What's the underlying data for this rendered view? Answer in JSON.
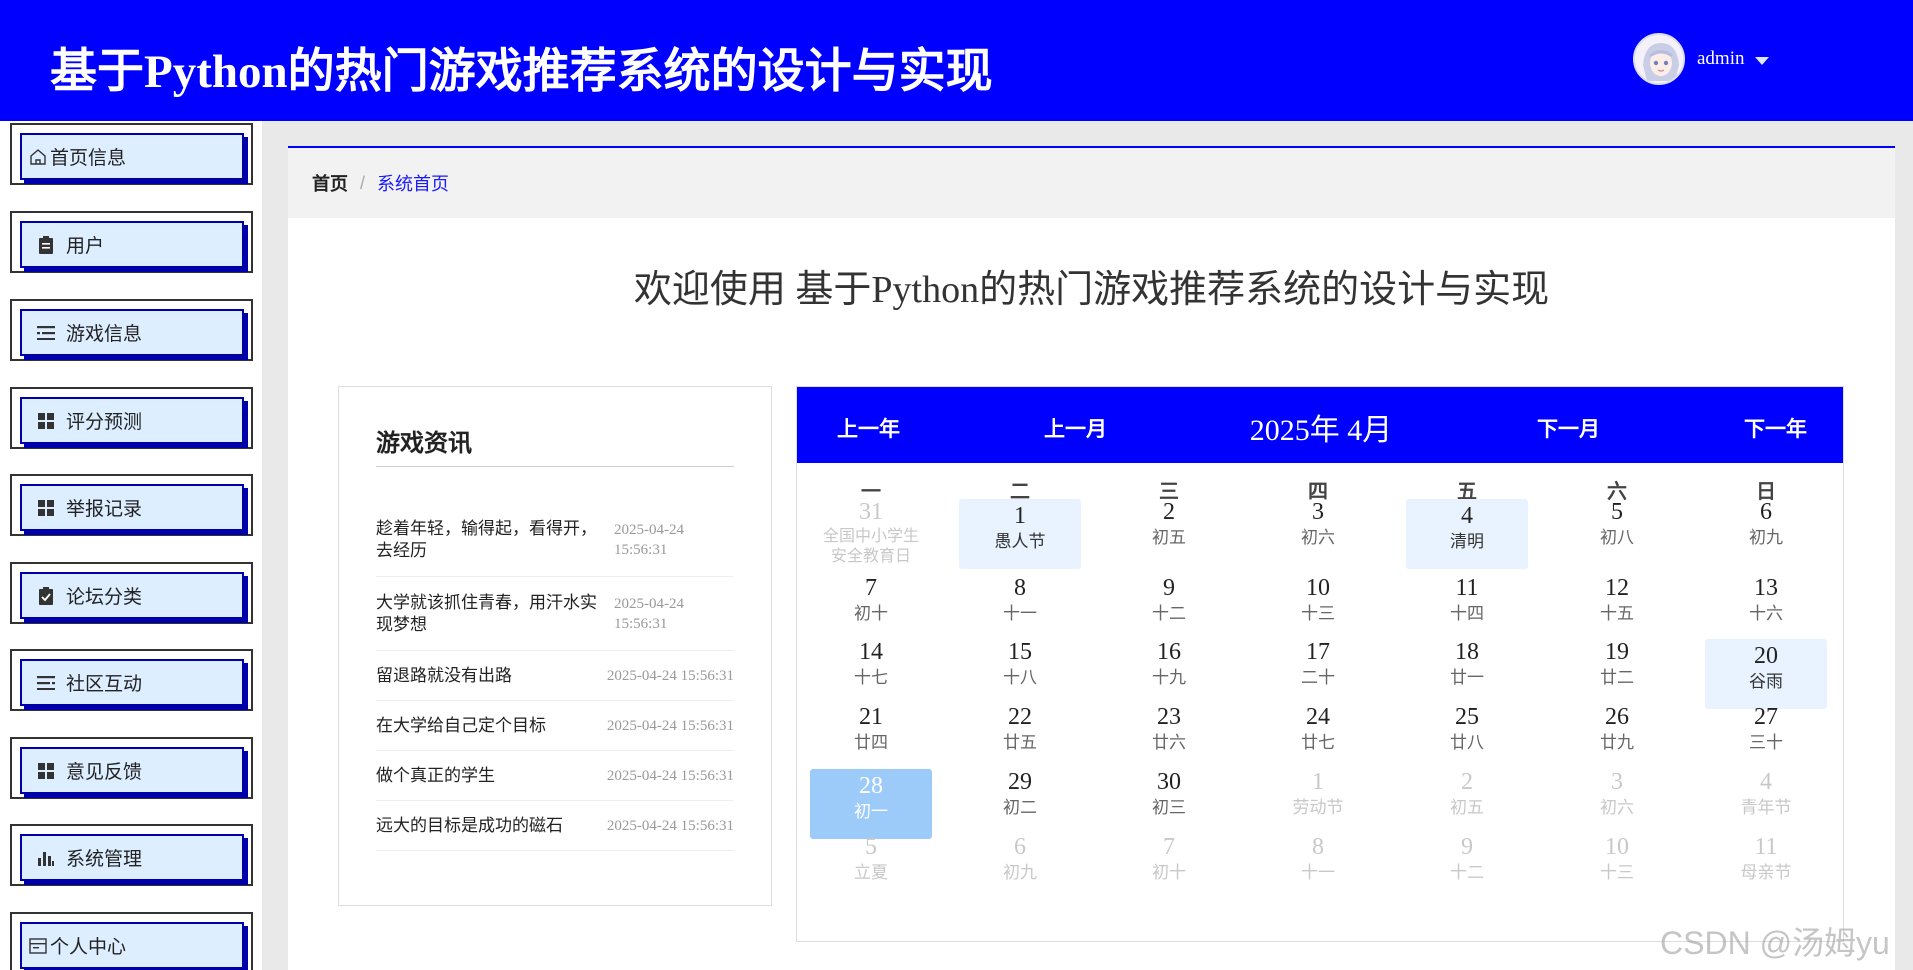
{
  "header": {
    "title": "基于Python的热门游戏推荐系统的设计与实现",
    "username": "admin"
  },
  "sidebar": {
    "items": [
      {
        "label": "首页信息",
        "icon": "home-icon"
      },
      {
        "label": "用户",
        "icon": "clipboard-icon"
      },
      {
        "label": "游戏信息",
        "icon": "list-icon"
      },
      {
        "label": "评分预测",
        "icon": "grid-icon"
      },
      {
        "label": "举报记录",
        "icon": "grid-icon"
      },
      {
        "label": "论坛分类",
        "icon": "clipboard-check-icon"
      },
      {
        "label": "社区互动",
        "icon": "list-icon"
      },
      {
        "label": "意见反馈",
        "icon": "grid-icon"
      },
      {
        "label": "系统管理",
        "icon": "bar-chart-icon"
      },
      {
        "label": "个人中心",
        "icon": "id-card-icon"
      }
    ]
  },
  "breadcrumb": {
    "home": "首页",
    "current": "系统首页"
  },
  "welcome": "欢迎使用 基于Python的热门游戏推荐系统的设计与实现",
  "news": {
    "title": "游戏资讯",
    "items": [
      {
        "title": "趁着年轻，输得起，看得开，去经历",
        "date": "2025-04-24",
        "time": "15:56:31"
      },
      {
        "title": "大学就该抓住青春，用汗水实现梦想",
        "date": "2025-04-24",
        "time": "15:56:31"
      },
      {
        "title": "留退路就没有出路",
        "datetime": "2025-04-24 15:56:31"
      },
      {
        "title": "在大学给自己定个目标",
        "datetime": "2025-04-24 15:56:31"
      },
      {
        "title": "做个真正的学生",
        "datetime": "2025-04-24 15:56:31"
      },
      {
        "title": "远大的目标是成功的磁石",
        "datetime": "2025-04-24 15:56:31"
      }
    ]
  },
  "calendar": {
    "prev_year": "上一年",
    "prev_month": "上一月",
    "year_month": "2025年 4月",
    "next_month": "下一月",
    "next_year": "下一年",
    "weekdays": [
      "一",
      "二",
      "三",
      "四",
      "五",
      "六",
      "日"
    ],
    "days": [
      {
        "n": "31",
        "l": "全国中小学生安全教育日",
        "other": true
      },
      {
        "n": "1",
        "l": "愚人节",
        "highlight": "light"
      },
      {
        "n": "2",
        "l": "初五"
      },
      {
        "n": "3",
        "l": "初六"
      },
      {
        "n": "4",
        "l": "清明",
        "highlight": "light"
      },
      {
        "n": "5",
        "l": "初八"
      },
      {
        "n": "6",
        "l": "初九"
      },
      {
        "n": "7",
        "l": "初十"
      },
      {
        "n": "8",
        "l": "十一"
      },
      {
        "n": "9",
        "l": "十二"
      },
      {
        "n": "10",
        "l": "十三"
      },
      {
        "n": "11",
        "l": "十四"
      },
      {
        "n": "12",
        "l": "十五"
      },
      {
        "n": "13",
        "l": "十六"
      },
      {
        "n": "14",
        "l": "十七"
      },
      {
        "n": "15",
        "l": "十八"
      },
      {
        "n": "16",
        "l": "十九"
      },
      {
        "n": "17",
        "l": "二十"
      },
      {
        "n": "18",
        "l": "廿一"
      },
      {
        "n": "19",
        "l": "廿二"
      },
      {
        "n": "20",
        "l": "谷雨",
        "highlight": "light"
      },
      {
        "n": "21",
        "l": "廿四"
      },
      {
        "n": "22",
        "l": "廿五"
      },
      {
        "n": "23",
        "l": "廿六"
      },
      {
        "n": "24",
        "l": "廿七"
      },
      {
        "n": "25",
        "l": "廿八"
      },
      {
        "n": "26",
        "l": "廿九"
      },
      {
        "n": "27",
        "l": "三十"
      },
      {
        "n": "28",
        "l": "初一",
        "highlight": "today"
      },
      {
        "n": "29",
        "l": "初二"
      },
      {
        "n": "30",
        "l": "初三"
      },
      {
        "n": "1",
        "l": "劳动节",
        "other": true
      },
      {
        "n": "2",
        "l": "初五",
        "other": true
      },
      {
        "n": "3",
        "l": "初六",
        "other": true
      },
      {
        "n": "4",
        "l": "青年节",
        "other": true
      },
      {
        "n": "5",
        "l": "立夏",
        "other": true
      },
      {
        "n": "6",
        "l": "初九",
        "other": true
      },
      {
        "n": "7",
        "l": "初十",
        "other": true
      },
      {
        "n": "8",
        "l": "十一",
        "other": true
      },
      {
        "n": "9",
        "l": "十二",
        "other": true
      },
      {
        "n": "10",
        "l": "十三",
        "other": true
      },
      {
        "n": "11",
        "l": "母亲节",
        "other": true
      }
    ]
  },
  "colors": {
    "primary": "#0000ff",
    "menu_bg": "#dceeff",
    "highlight_light": "#e8f3ff",
    "highlight_today": "#9ccbfa"
  },
  "watermark": "CSDN @汤姆yu"
}
